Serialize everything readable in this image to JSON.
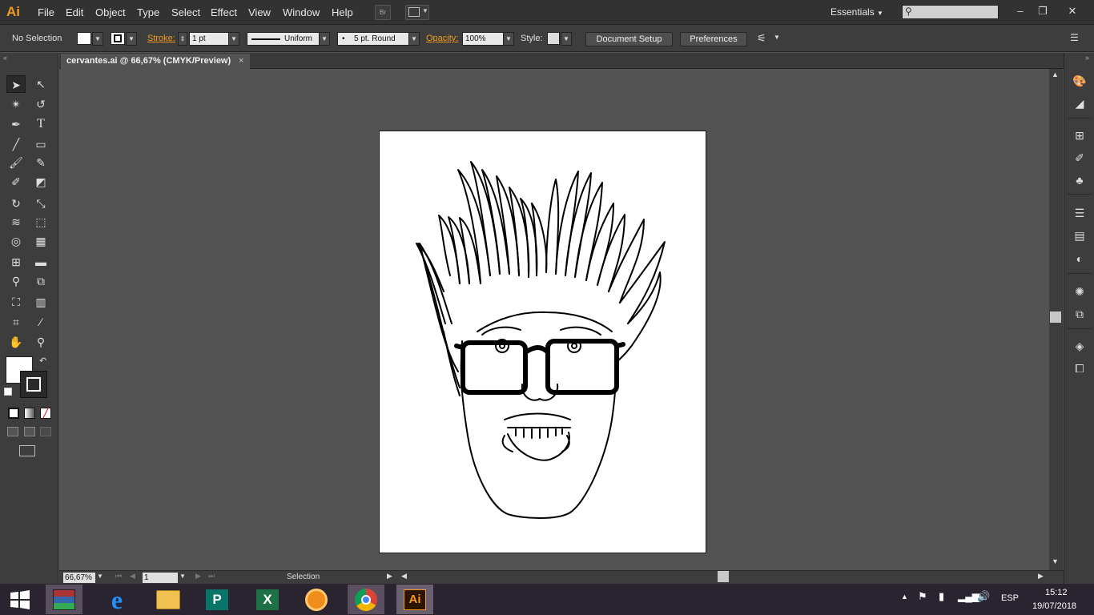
{
  "app": {
    "logo": "Ai"
  },
  "menu": [
    "File",
    "Edit",
    "Object",
    "Type",
    "Select",
    "Effect",
    "View",
    "Window",
    "Help"
  ],
  "bridge_button": "Br",
  "workspace": "Essentials",
  "search": {
    "placeholder": ""
  },
  "control": {
    "selection": "No Selection",
    "stroke_label": "Stroke:",
    "stroke_weight": "1 pt",
    "profile": "Uniform",
    "brush": "5 pt. Round",
    "opacity_label": "Opacity:",
    "opacity": "100%",
    "style_label": "Style:",
    "document_setup": "Document Setup",
    "preferences": "Preferences"
  },
  "document": {
    "tab_title": "cervantes.ai @ 66,67% (CMYK/Preview)",
    "close": "×"
  },
  "status": {
    "zoom": "66,67%",
    "page": "1",
    "tool": "Selection"
  },
  "taskbar": {
    "time": "15:12",
    "date": "19/07/2018",
    "lang": "ESP",
    "ai_label": "Ai"
  },
  "colors": {
    "accent": "#f29b1f",
    "panel": "#3d3d3d",
    "canvas": "#535353",
    "menubar": "#323232",
    "taskbar": "#2a2330"
  }
}
